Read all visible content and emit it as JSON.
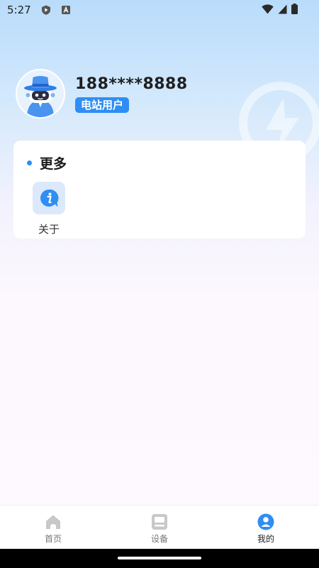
{
  "status_bar": {
    "time": "5:27",
    "icons": [
      "play-protect-icon",
      "keyboard-a-icon",
      "wifi-icon",
      "signal-icon",
      "battery-icon"
    ]
  },
  "profile": {
    "phone": "188****8888",
    "badge": "电站用户",
    "avatar_icon": "robot-detective-avatar"
  },
  "more_section": {
    "title": "更多",
    "items": [
      {
        "label": "关于",
        "icon": "info-icon"
      }
    ]
  },
  "bottom_nav": {
    "items": [
      {
        "label": "首页",
        "icon": "home-icon",
        "active": false
      },
      {
        "label": "设备",
        "icon": "device-icon",
        "active": false
      },
      {
        "label": "我的",
        "icon": "user-icon",
        "active": true
      }
    ]
  },
  "colors": {
    "accent": "#2f8ef3",
    "nav_inactive": "#c8c8c8",
    "gradient_top": "#b9dcfb",
    "background": "#fdf9fe"
  }
}
